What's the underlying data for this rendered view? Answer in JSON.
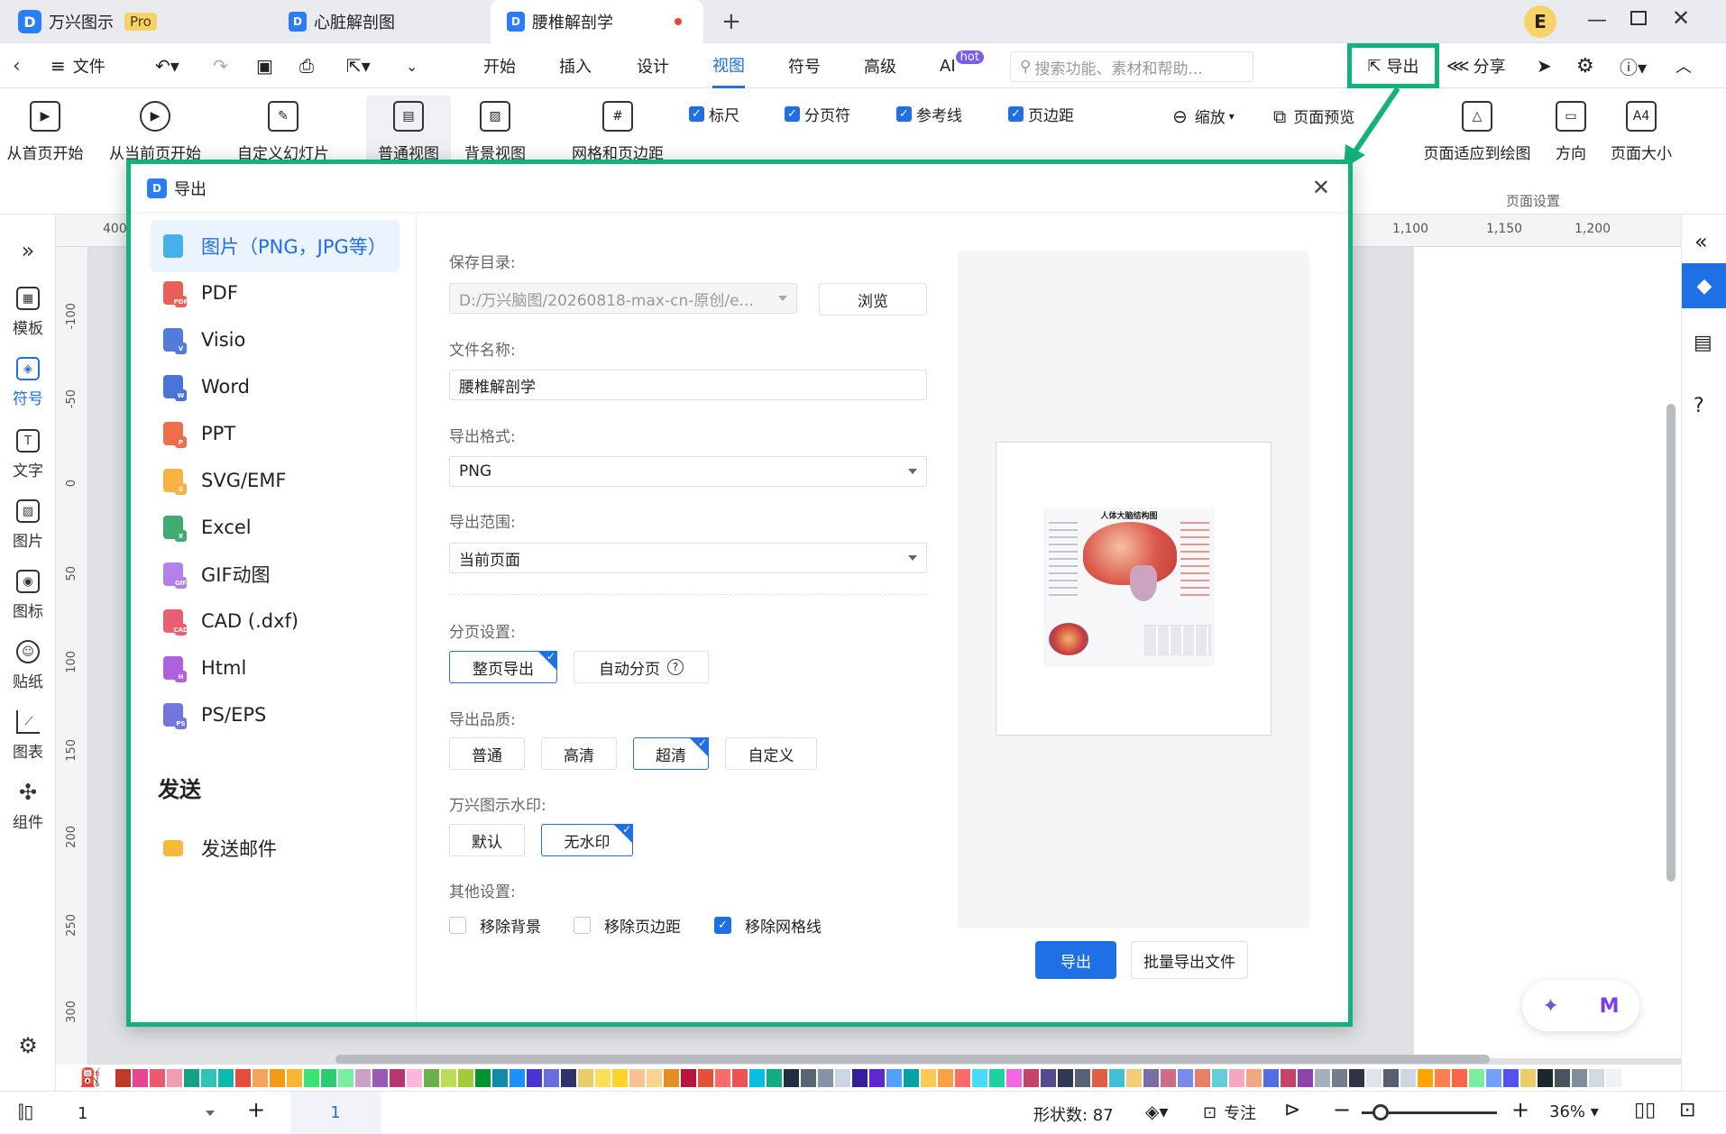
{
  "app": {
    "title": "万兴图示",
    "badge": "Pro"
  },
  "tabs": [
    {
      "label": "心脏解剖图"
    },
    {
      "label": "腰椎解剖学"
    }
  ],
  "window": {
    "user_initial": "E"
  },
  "menubar": {
    "file": "文件",
    "menus": [
      "开始",
      "插入",
      "设计",
      "视图",
      "符号",
      "高级",
      "AI"
    ],
    "active_menu": "视图",
    "ai_badge": "hot",
    "search_placeholder": "搜索功能、素材和帮助...",
    "export": "导出",
    "share": "分享"
  },
  "ribbon": {
    "slideshow": [
      "从首页开始",
      "从当前页开始",
      "自定义幻灯片"
    ],
    "views": [
      "普通视图",
      "背景视图"
    ],
    "grid": "网格和页边距",
    "checks": [
      "标尺",
      "分页符",
      "参考线",
      "页边距"
    ],
    "zoom": "缩放",
    "preview": "页面预览",
    "page_fit": "页面适应到绘图",
    "orientation": "方向",
    "page_size": "页面大小",
    "page_size_icon": "A4",
    "page_setup_group": "页面设置"
  },
  "left_sidebar": [
    "模板",
    "符号",
    "文字",
    "图片",
    "图标",
    "贴纸",
    "图表",
    "组件"
  ],
  "ruler": {
    "top": [
      "400",
      "1,100",
      "1,150",
      "1,200"
    ],
    "left": [
      "-100",
      "-50",
      "0",
      "50",
      "100",
      "150",
      "200",
      "250",
      "300"
    ]
  },
  "dialog": {
    "title": "导出",
    "formats": [
      {
        "label": "图片（PNG，JPG等）",
        "icon": "image-icon",
        "color": "#29a3e8",
        "tag": ""
      },
      {
        "label": "PDF",
        "icon": "pdf-icon",
        "color": "#e8433a",
        "tag": "PDF"
      },
      {
        "label": "Visio",
        "icon": "visio-icon",
        "color": "#3566d6",
        "tag": "V"
      },
      {
        "label": "Word",
        "icon": "word-icon",
        "color": "#2b5cd1",
        "tag": "W"
      },
      {
        "label": "PPT",
        "icon": "ppt-icon",
        "color": "#e8572e",
        "tag": "P"
      },
      {
        "label": "SVG/EMF",
        "icon": "svg-icon",
        "color": "#f5a623",
        "tag": "S"
      },
      {
        "label": "Excel",
        "icon": "excel-icon",
        "color": "#1f9d55",
        "tag": "X"
      },
      {
        "label": "GIF动图",
        "icon": "gif-icon",
        "color": "#a46be8",
        "tag": "GIF"
      },
      {
        "label": "CAD (.dxf)",
        "icon": "cad-icon",
        "color": "#e8435a",
        "tag": "CAD"
      },
      {
        "label": "Html",
        "icon": "html-icon",
        "color": "#a445d8",
        "tag": "H"
      },
      {
        "label": "PS/EPS",
        "icon": "ps-icon",
        "color": "#5b5fd9",
        "tag": "PS"
      }
    ],
    "send_heading": "发送",
    "send_email": "发送邮件",
    "save_dir_label": "保存目录:",
    "save_dir_value": "D:/万兴脑图/20260818-max-cn-原创/e...",
    "browse": "浏览",
    "filename_label": "文件名称:",
    "filename_value": "腰椎解剖学",
    "format_label": "导出格式:",
    "format_value": "PNG",
    "range_label": "导出范围:",
    "range_value": "当前页面",
    "paging_label": "分页设置:",
    "paging_options": [
      "整页导出",
      "自动分页"
    ],
    "quality_label": "导出品质:",
    "quality_options": [
      "普通",
      "高清",
      "超清",
      "自定义"
    ],
    "watermark_label": "万兴图示水印:",
    "watermark_options": [
      "默认",
      "无水印"
    ],
    "other_label": "其他设置:",
    "other_options": [
      {
        "label": "移除背景",
        "checked": false
      },
      {
        "label": "移除页边距",
        "checked": false
      },
      {
        "label": "移除网格线",
        "checked": true
      }
    ],
    "export_button": "导出",
    "batch_button": "批量导出文件",
    "preview_title": "人体大脑结构图"
  },
  "statusbar": {
    "page_select": "1",
    "page_tab": "1",
    "shape_count": "形状数: 87",
    "focus": "专注",
    "zoom": "36%"
  },
  "colors": {
    "accent": "#1f6fe5",
    "highlight": "#12b37a"
  }
}
